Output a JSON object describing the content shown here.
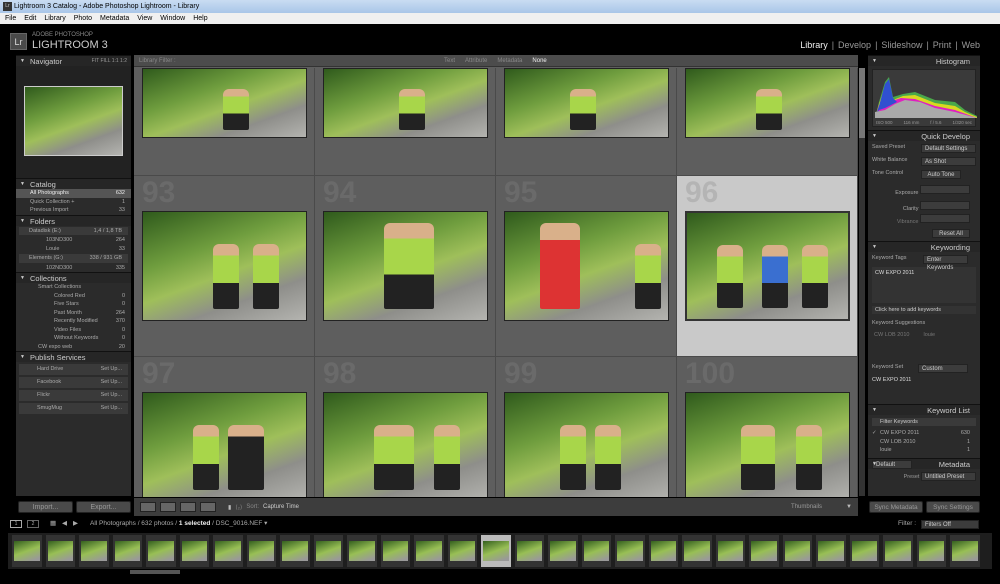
{
  "window": {
    "title": "Lightroom 3 Catalog - Adobe Photoshop Lightroom - Library",
    "icon": "Lr"
  },
  "menu": [
    "File",
    "Edit",
    "Library",
    "Photo",
    "Metadata",
    "View",
    "Window",
    "Help"
  ],
  "logo": {
    "line1": "ADOBE PHOTOSHOP",
    "line2": "LIGHTROOM 3",
    "badge": "Lr"
  },
  "modules": [
    "Library",
    "Develop",
    "Slideshow",
    "Print",
    "Web"
  ],
  "navigator": {
    "title": "Navigator",
    "zoom": [
      "FIT",
      "FILL",
      "1:1",
      "1:2"
    ]
  },
  "catalog": {
    "title": "Catalog",
    "items": [
      {
        "label": "All Photographs",
        "count": "632"
      },
      {
        "label": "Quick Collection +",
        "count": "1"
      },
      {
        "label": "Previous Import",
        "count": "33"
      }
    ]
  },
  "folders": {
    "title": "Folders",
    "volumes": [
      {
        "label": "Datadisk (E:)",
        "size": "1,4 / 1,8 TB",
        "items": [
          {
            "label": "103ND300",
            "count": "264"
          },
          {
            "label": "Louie",
            "count": "33"
          }
        ]
      },
      {
        "label": "Elements (G:)",
        "size": "338 / 931 GB",
        "items": [
          {
            "label": "102ND300",
            "count": "335"
          }
        ]
      }
    ]
  },
  "collections": {
    "title": "Collections",
    "smart": "Smart Collections",
    "items": [
      {
        "label": "Colored Red",
        "count": "0"
      },
      {
        "label": "Five Stars",
        "count": "0"
      },
      {
        "label": "Past Month",
        "count": "264"
      },
      {
        "label": "Recently Modified",
        "count": "370"
      },
      {
        "label": "Video Files",
        "count": "0"
      },
      {
        "label": "Without Keywords",
        "count": "0"
      }
    ],
    "other": {
      "label": "CW expo web",
      "count": "20"
    }
  },
  "publish": {
    "title": "Publish Services",
    "items": [
      {
        "label": "Hard Drive",
        "action": "Set Up..."
      },
      {
        "label": "Facebook",
        "action": "Set Up..."
      },
      {
        "label": "Flickr",
        "action": "Set Up..."
      },
      {
        "label": "SmugMug",
        "action": "Set Up..."
      }
    ]
  },
  "left_buttons": {
    "import": "Import...",
    "export": "Export..."
  },
  "library_filter": {
    "label": "Library Filter :",
    "tabs": [
      "Text",
      "Attribute",
      "Metadata",
      "None"
    ],
    "active": "None"
  },
  "grid": {
    "cells": [
      "93",
      "94",
      "95",
      "96",
      "97",
      "98",
      "99",
      "100"
    ],
    "selected": "96"
  },
  "toolbar": {
    "sort_label": "Sort:",
    "sort_value": "Capture Time",
    "thumbnails": "Thumbnails"
  },
  "histogram": {
    "title": "Histogram",
    "iso": "ISO 500",
    "focal": "116 mm",
    "aperture": "f / 5.6",
    "shutter": "1/320 sec"
  },
  "quick_develop": {
    "title": "Quick Develop",
    "saved_preset_label": "Saved Preset",
    "saved_preset": "Default Settings",
    "wb_label": "White Balance",
    "wb": "As Shot",
    "tone_label": "Tone Control",
    "auto_tone": "Auto Tone",
    "exposure": "Exposure",
    "clarity": "Clarity",
    "vibrance": "Vibrance",
    "reset": "Reset All"
  },
  "keywording": {
    "title": "Keywording",
    "tags_label": "Keyword Tags",
    "tags_mode": "Enter Keywords",
    "tags": "CW EXPO 2011",
    "add_hint": "Click here to add keywords",
    "suggestions_label": "Keyword Suggestions",
    "suggestions": [
      "CW LOB 2010",
      "louie"
    ],
    "set_label": "Keyword Set",
    "set_value": "Custom",
    "set_items": [
      "CW EXPO 2011"
    ]
  },
  "keyword_list": {
    "title": "Keyword List",
    "filter": "Filter Keywords",
    "items": [
      {
        "label": "CW EXPO 2011",
        "count": "630",
        "checked": true
      },
      {
        "label": "CW LOB 2010",
        "count": "1"
      },
      {
        "label": "louie",
        "count": "1"
      }
    ]
  },
  "metadata": {
    "title": "Metadata",
    "preset_select": "Default",
    "preset_label": "Preset",
    "preset": "Untitled Preset"
  },
  "sync": {
    "metadata": "Sync Metadata",
    "settings": "Sync Settings"
  },
  "filmstrip": {
    "pages": [
      "1",
      "2"
    ],
    "path": "All Photographs / 632 photos / ",
    "selected": "1 selected",
    "file": " / DSC_9016.NEF",
    "filter_label": "Filter :",
    "filter_value": "Filters Off"
  }
}
